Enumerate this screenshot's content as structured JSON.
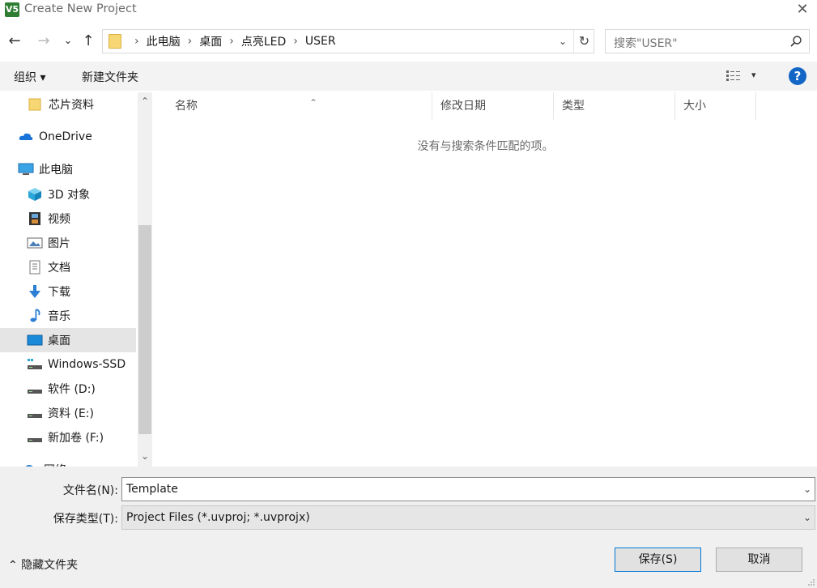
{
  "window": {
    "title": "Create New Project",
    "app_icon_text": "V5"
  },
  "nav_buttons": {
    "back": "←",
    "forward": "→",
    "recent": "⌄",
    "up": "↑"
  },
  "address": {
    "crumbs": [
      "此电脑",
      "桌面",
      "点亮LED",
      "USER"
    ],
    "separator": "›",
    "dropdown": "⌄",
    "refresh": "↻"
  },
  "search": {
    "placeholder": "搜索\"USER\""
  },
  "toolbar": {
    "organize": "组织 ▾",
    "new_folder": "新建文件夹",
    "view_arrow": "▾",
    "help": "?"
  },
  "nav_pane": {
    "items": [
      {
        "label": "芯片资料",
        "icon": "folder-icon"
      },
      {
        "label": "OneDrive",
        "icon": "cloud-icon"
      },
      {
        "label": "此电脑",
        "icon": "computer-icon"
      },
      {
        "label": "3D 对象",
        "icon": "cube-icon"
      },
      {
        "label": "视频",
        "icon": "film-icon"
      },
      {
        "label": "图片",
        "icon": "picture-icon"
      },
      {
        "label": "文档",
        "icon": "document-icon"
      },
      {
        "label": "下载",
        "icon": "download-icon"
      },
      {
        "label": "音乐",
        "icon": "music-icon"
      },
      {
        "label": "桌面",
        "icon": "desktop-icon",
        "selected": true
      },
      {
        "label": "Windows-SSD",
        "icon": "drive-icon"
      },
      {
        "label": "软件 (D:)",
        "icon": "drive-icon"
      },
      {
        "label": "资料 (E:)",
        "icon": "drive-icon"
      },
      {
        "label": "新加卷 (F:)",
        "icon": "drive-icon"
      },
      {
        "label": "网络",
        "icon": "network-icon"
      }
    ],
    "scroll_up": "⌃",
    "scroll_down": "⌄"
  },
  "columns": [
    "名称",
    "修改日期",
    "类型",
    "大小"
  ],
  "sort_indicator": "⌃",
  "empty_message": "没有与搜索条件匹配的项。",
  "form": {
    "filename_label": "文件名(N):",
    "filename_value": "Template",
    "filetype_label": "保存类型(T):",
    "filetype_value": "Project Files (*.uvproj; *.uvprojx)",
    "combo_arrow": "⌄"
  },
  "footer": {
    "hide_folders": "⌃ 隐藏文件夹",
    "save": "保存(S)",
    "cancel": "取消"
  },
  "colors": {
    "accent": "#0078d7",
    "selected_bg": "#e5e5e5",
    "toolbar_bg": "#f3f3f3",
    "bottom_bg": "#f0f0f0",
    "help_blue": "#1466c6"
  }
}
